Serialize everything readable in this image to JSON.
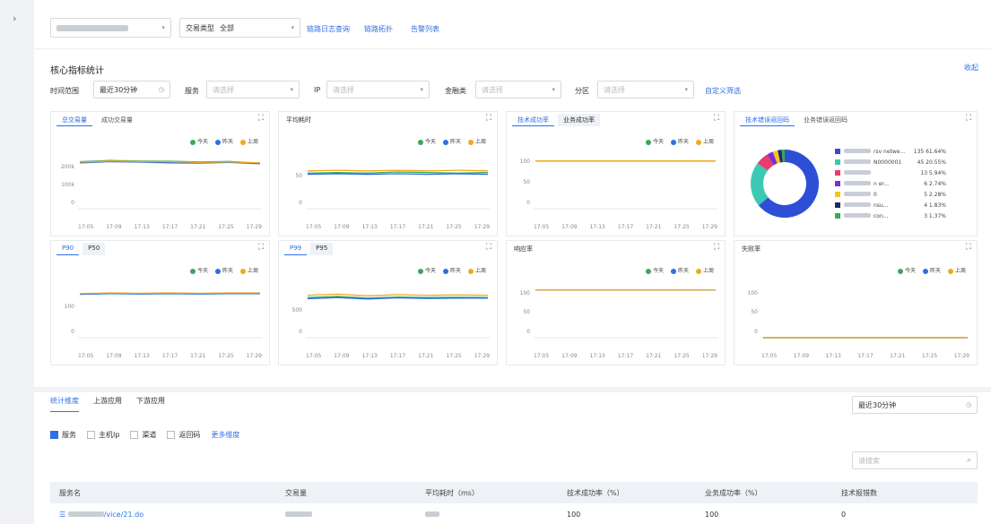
{
  "sidebar": {
    "toggle_icon": "chevron-right-icon"
  },
  "topbar": {
    "tx_type_label": "交易类型",
    "tx_type_value": "全部",
    "links": [
      "链路日志查询",
      "链路拓扑",
      "告警列表"
    ]
  },
  "card": {
    "title": "核心指标统计",
    "collapse_label": "收起"
  },
  "filters": {
    "time_label": "时间范围",
    "time_value": "最近30分钟",
    "service_label": "服务",
    "service_placeholder": "请选择",
    "ip_label": "IP",
    "ip_placeholder": "请选择",
    "fin_label": "金融类",
    "fin_placeholder": "请选择",
    "zone_label": "分区",
    "zone_placeholder": "请选择",
    "custom_label": "自定义筛选"
  },
  "legend": {
    "today": "今天",
    "yesterday": "昨天",
    "last_week": "上周"
  },
  "colors": {
    "today": "#3aa85a",
    "yesterday": "#2d6fe6",
    "last_week": "#f0a91a",
    "accent": "#2d6fe6"
  },
  "x_ticks": [
    "17:05",
    "17:09",
    "17:13",
    "17:17",
    "17:21",
    "17:25",
    "17:29"
  ],
  "panels": {
    "p1": {
      "tabs": [
        "总交易量",
        "成功交易量"
      ],
      "y_ticks": [
        "200k",
        "100k",
        "0"
      ]
    },
    "p2": {
      "title": "平均耗时",
      "y_ticks": [
        "50",
        "0"
      ]
    },
    "p3": {
      "tabs": [
        "技术成功率",
        "业务成功率"
      ],
      "y_ticks": [
        "100",
        "50",
        "0"
      ]
    },
    "p4": {
      "tabs": [
        "技术错误返回码",
        "业务错误返回码"
      ]
    },
    "p5": {
      "tabs": [
        "P90",
        "P50"
      ],
      "y_ticks": [
        "100",
        "0"
      ]
    },
    "p6": {
      "tabs": [
        "P99",
        "P95"
      ],
      "y_ticks": [
        "500",
        "0"
      ]
    },
    "p7": {
      "title": "响应率",
      "y_ticks": [
        "100",
        "50",
        "0"
      ]
    },
    "p8": {
      "title": "失败率",
      "y_ticks": [
        "100",
        "50",
        "0"
      ]
    }
  },
  "pie_legend": [
    {
      "name": "rsv netwe...",
      "value": "135",
      "pct": "61.64%",
      "color": "#2d4fd6"
    },
    {
      "name": "N0000001",
      "value": "45",
      "pct": "20.55%",
      "color": "#3cc9b4"
    },
    {
      "name": "",
      "value": "13",
      "pct": "5.94%",
      "color": "#e63d6a"
    },
    {
      "name": "n er...",
      "value": "6",
      "pct": "2.74%",
      "color": "#7a2ddb"
    },
    {
      "name": "0",
      "value": "5",
      "pct": "2.28%",
      "color": "#f5c518"
    },
    {
      "name": "nsu...",
      "value": "4",
      "pct": "1.83%",
      "color": "#1d2a66"
    },
    {
      "name": "con...",
      "value": "3",
      "pct": "1.37%",
      "color": "#3aa85a"
    }
  ],
  "chart_data": [
    {
      "type": "line",
      "x": [
        "17:05",
        "17:09",
        "17:13",
        "17:17",
        "17:21",
        "17:25",
        "17:29"
      ],
      "ylim": [
        0,
        250000
      ],
      "series": [
        {
          "name": "今天",
          "values": [
            205000,
            210000,
            208000,
            207000,
            204000,
            206000,
            198000
          ]
        },
        {
          "name": "昨天",
          "values": [
            200000,
            205000,
            203000,
            200000,
            199000,
            202000,
            196000
          ]
        },
        {
          "name": "上周",
          "values": [
            203000,
            208000,
            206000,
            205000,
            202000,
            204000,
            200000
          ]
        }
      ]
    },
    {
      "type": "line",
      "x": [
        "17:05",
        "17:09",
        "17:13",
        "17:17",
        "17:21",
        "17:25",
        "17:29"
      ],
      "ylim": [
        0,
        100
      ],
      "series": [
        {
          "name": "今天",
          "values": [
            62,
            63,
            62,
            64,
            63,
            62,
            63
          ]
        },
        {
          "name": "昨天",
          "values": [
            60,
            61,
            60,
            61,
            60,
            61,
            60
          ]
        },
        {
          "name": "上周",
          "values": [
            66,
            67,
            66,
            67,
            66,
            67,
            66
          ]
        }
      ]
    },
    {
      "type": "line",
      "x": [
        "17:05",
        "17:09",
        "17:13",
        "17:17",
        "17:21",
        "17:25",
        "17:29"
      ],
      "ylim": [
        0,
        120
      ],
      "series": [
        {
          "name": "今天",
          "values": [
            100,
            100,
            100,
            100,
            100,
            100,
            100
          ]
        },
        {
          "name": "昨天",
          "values": [
            100,
            100,
            100,
            100,
            100,
            100,
            100
          ]
        },
        {
          "name": "上周",
          "values": [
            100,
            100,
            100,
            100,
            100,
            100,
            100
          ]
        }
      ]
    },
    {
      "type": "pie",
      "categories": [
        "rsv netwe...",
        "N0000001",
        "",
        "n er...",
        "0",
        "nsu...",
        "con..."
      ],
      "values": [
        135,
        45,
        13,
        6,
        5,
        4,
        3
      ]
    },
    {
      "type": "line",
      "x": [
        "17:05",
        "17:09",
        "17:13",
        "17:17",
        "17:21",
        "17:25",
        "17:29"
      ],
      "ylim": [
        0,
        160
      ],
      "series": [
        {
          "name": "今天",
          "values": [
            122,
            124,
            123,
            124,
            123,
            124,
            124
          ]
        },
        {
          "name": "昨天",
          "values": [
            121,
            123,
            122,
            123,
            122,
            123,
            123
          ]
        },
        {
          "name": "上周",
          "values": [
            123,
            125,
            124,
            125,
            124,
            125,
            125
          ]
        }
      ]
    },
    {
      "type": "line",
      "x": [
        "17:05",
        "17:09",
        "17:13",
        "17:17",
        "17:21",
        "17:25",
        "17:29"
      ],
      "ylim": [
        0,
        1000
      ],
      "series": [
        {
          "name": "今天",
          "values": [
            700,
            720,
            690,
            710,
            700,
            705,
            700
          ]
        },
        {
          "name": "昨天",
          "values": [
            680,
            700,
            675,
            695,
            685,
            690,
            690
          ]
        },
        {
          "name": "上周",
          "values": [
            740,
            760,
            730,
            750,
            740,
            745,
            740
          ]
        }
      ]
    },
    {
      "type": "line",
      "x": [
        "17:05",
        "17:09",
        "17:13",
        "17:17",
        "17:21",
        "17:25",
        "17:29"
      ],
      "ylim": [
        0,
        120
      ],
      "series": [
        {
          "name": "今天",
          "values": [
            100,
            100,
            100,
            100,
            100,
            100,
            100
          ]
        },
        {
          "name": "昨天",
          "values": [
            100,
            100,
            100,
            100,
            100,
            100,
            100
          ]
        },
        {
          "name": "上周",
          "values": [
            100,
            100,
            100,
            100,
            100,
            100,
            100
          ]
        }
      ]
    },
    {
      "type": "line",
      "x": [
        "17:05",
        "17:09",
        "17:13",
        "17:17",
        "17:21",
        "17:25",
        "17:29"
      ],
      "ylim": [
        0,
        120
      ],
      "series": [
        {
          "name": "今天",
          "values": [
            0,
            0,
            0,
            0,
            0,
            0,
            0
          ]
        },
        {
          "name": "昨天",
          "values": [
            0,
            0,
            0,
            0,
            0,
            0,
            0
          ]
        },
        {
          "name": "上周",
          "values": [
            0,
            0,
            0,
            0,
            0,
            0,
            0
          ]
        }
      ]
    }
  ],
  "bottom": {
    "tabs": [
      "统计维度",
      "上游应用",
      "下游应用"
    ],
    "time_select": "最近30分钟",
    "checks": [
      {
        "label": "服务",
        "on": true
      },
      {
        "label": "主机Ip",
        "on": false
      },
      {
        "label": "渠道",
        "on": false
      },
      {
        "label": "返回码",
        "on": false
      }
    ],
    "more_dims": "更多维度",
    "search_placeholder": "请搜索",
    "columns": [
      "服务名",
      "交易量",
      "平均耗时（ms）",
      "技术成功率（%）",
      "业务成功率（%）",
      "技术报错数"
    ],
    "row": {
      "service": "/vice/21.do",
      "tech_rate": "100",
      "biz_rate": "100",
      "errors": "0"
    }
  }
}
